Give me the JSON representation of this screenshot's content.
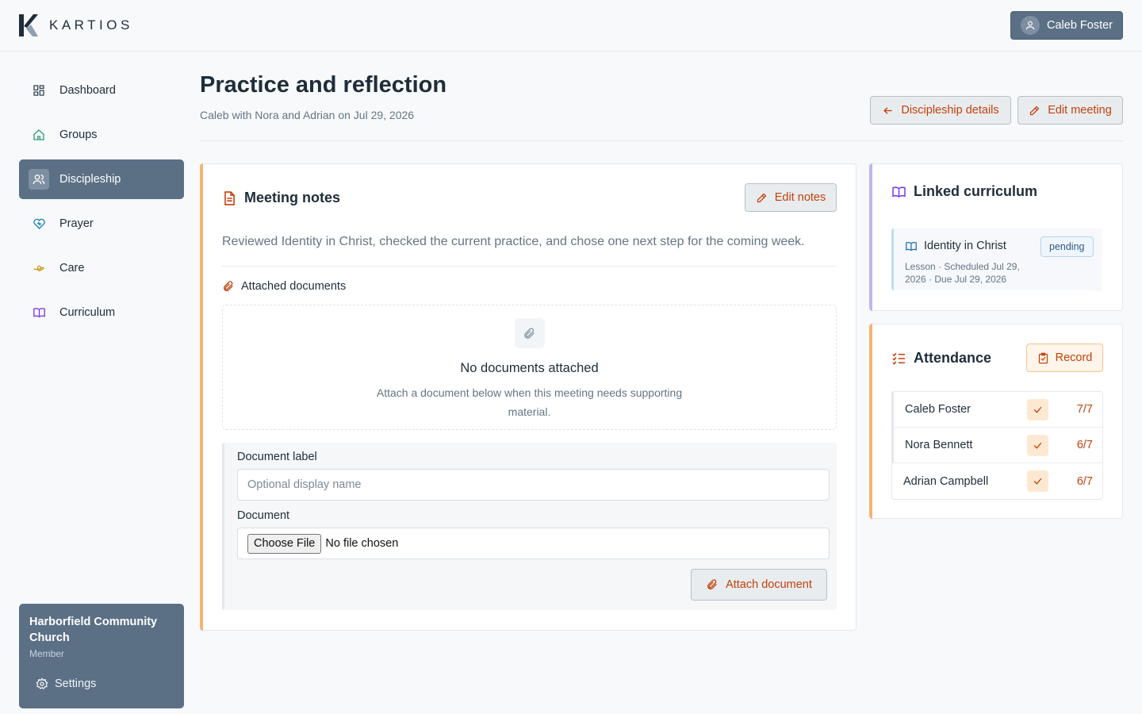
{
  "app": {
    "brand": "KARTIOS"
  },
  "user": {
    "name": "Caleb Foster"
  },
  "nav": {
    "items": [
      {
        "label": "Dashboard",
        "icon": "dashboard-icon",
        "active": false
      },
      {
        "label": "Groups",
        "icon": "home-icon",
        "active": false
      },
      {
        "label": "Discipleship",
        "icon": "users-icon",
        "active": true
      },
      {
        "label": "Prayer",
        "icon": "heart-icon",
        "active": false
      },
      {
        "label": "Care",
        "icon": "care-hands-icon",
        "active": false
      },
      {
        "label": "Curriculum",
        "icon": "book-icon",
        "active": false
      }
    ]
  },
  "org": {
    "name": "Harborfield Community Church",
    "role": "Member",
    "settings_label": "Settings"
  },
  "header": {
    "title": "Practice and reflection",
    "subtitle": "Caleb with Nora and Adrian on Jul 29, 2026",
    "back_label": "Discipleship details",
    "edit_label": "Edit meeting"
  },
  "notes": {
    "title": "Meeting notes",
    "edit_label": "Edit notes",
    "text": "Reviewed Identity in Christ, checked the current practice, and chose one next step for the coming week.",
    "attached_heading": "Attached documents",
    "empty_title": "No documents attached",
    "empty_desc": "Attach a document below when this meeting needs supporting material.",
    "form": {
      "label_label": "Document label",
      "label_placeholder": "Optional display name",
      "doc_label": "Document",
      "choose_label": "Choose File",
      "no_file": "No file chosen",
      "submit_label": "Attach document"
    }
  },
  "curriculum": {
    "title": "Linked curriculum",
    "item": {
      "title": "Identity in Christ",
      "meta": "Lesson · Scheduled Jul 29, 2026 · Due Jul 29, 2026",
      "status": "pending"
    }
  },
  "attendance": {
    "title": "Attendance",
    "record_label": "Record",
    "rows": [
      {
        "name": "Caleb Foster",
        "score": "7/7"
      },
      {
        "name": "Nora Bennett",
        "score": "6/7"
      },
      {
        "name": "Adrian Campbell",
        "score": "6/7"
      }
    ]
  },
  "colors": {
    "accent": "#c2410c",
    "sidebar_active": "#5b7085",
    "notes_bar": "#f5b472",
    "curriculum_bar": "#c4b4f0"
  }
}
